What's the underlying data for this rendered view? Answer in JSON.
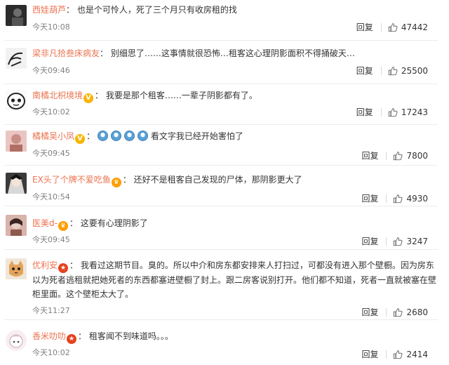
{
  "comments": [
    {
      "name": "西娃葫芦",
      "badge": "",
      "emoji_count": 0,
      "text": "也是个可怜人，死了三个月只有收房租的找",
      "time": "今天10:08",
      "reply": "回复",
      "likes": "47442",
      "avatar_icon": "dark-portrait-avatar"
    },
    {
      "name": "梁非凡拾叁床病友",
      "badge": "",
      "emoji_count": 0,
      "text": "别细思了……这事情就很恐怖…租客这心理阴影面积不得捅破天…",
      "time": "今天09:46",
      "reply": "回复",
      "likes": "25500",
      "avatar_icon": "sketch-avatar"
    },
    {
      "name": "南橘北枳境境",
      "badge": "v",
      "emoji_count": 0,
      "text": "我要是那个租客……一辈子阴影都有了。",
      "time": "今天10:02",
      "reply": "回复",
      "likes": "17243",
      "avatar_icon": "cartoon-face-avatar"
    },
    {
      "name": "橘橘吴小凤",
      "badge": "v",
      "emoji_count": 4,
      "text": "看文字我已经开始害怕了",
      "time": "今天09:45",
      "reply": "回复",
      "likes": "7800",
      "avatar_icon": "pink-photo-avatar"
    },
    {
      "name": "EX头了个牌不爱吃鱼",
      "badge": "crown",
      "emoji_count": 0,
      "text": "还好不是租客自己发现的尸体，那阴影更大了",
      "time": "今天10:54",
      "reply": "回复",
      "likes": "4930",
      "avatar_icon": "anime-avatar"
    },
    {
      "name": "医美d-",
      "badge": "crown",
      "emoji_count": 0,
      "text": "这要有心理阴影了",
      "time": "今天09:45",
      "reply": "回复",
      "likes": "3247",
      "avatar_icon": "portrait-photo-avatar"
    },
    {
      "name": "优利安",
      "badge": "star",
      "emoji_count": 0,
      "text": "我看过这期节目。臭的。所以中介和房东都安排来人打扫过，可都没有进入那个壁橱。因为房东以为死者逃租就把她死者的东西都塞进壁橱了封上。跟二房客说别打开。他们都不知道，死者一直就被塞在壁柜里面。这个壁柜太大了。",
      "time": "今天11:27",
      "reply": "回复",
      "likes": "2680",
      "avatar_icon": "cat-avatar"
    },
    {
      "name": "香米叻叻",
      "badge": "star",
      "emoji_count": 0,
      "text": "租客闻不到味道吗。。。",
      "time": "今天10:02",
      "reply": "回复",
      "likes": "2414",
      "avatar_icon": "cartoon-girl-avatar"
    }
  ],
  "colors": {
    "name": "#eb7350",
    "text": "#333333",
    "meta": "#808080",
    "badge_v": "#f7b400",
    "badge_star": "#e6421f"
  }
}
